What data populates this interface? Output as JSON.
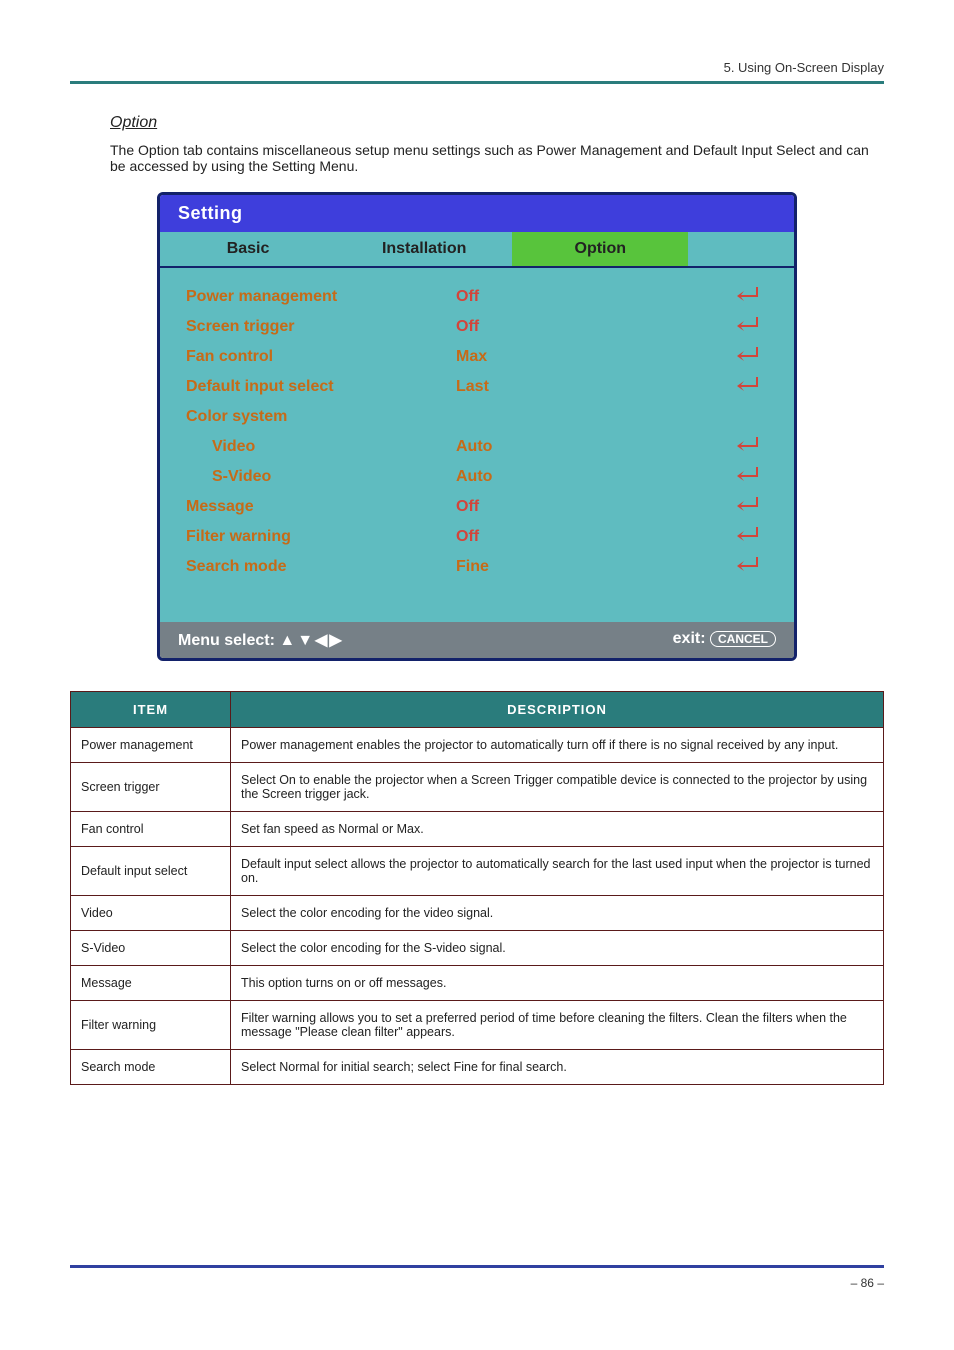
{
  "header": {
    "right_text": "5. Using On-Screen Display"
  },
  "section": {
    "title_underlined": "Option",
    "desc": "The Option tab contains miscellaneous setup menu settings such as Power Management and Default Input Select and can be accessed by using the Setting Menu."
  },
  "osd": {
    "title": "Setting",
    "tabs": {
      "basic": "Basic",
      "installation": "Installation",
      "option": "Option"
    },
    "rows": {
      "power_mgmt": {
        "label": "Power management",
        "value": "Off"
      },
      "screen_trigger": {
        "label": "Screen trigger",
        "value": "Off"
      },
      "fan_control": {
        "label": "Fan control",
        "value": "Max"
      },
      "default_input": {
        "label": "Default input select",
        "value": "Last"
      },
      "color_system": {
        "label": "Color system"
      },
      "video": {
        "label": "Video",
        "value": "Auto"
      },
      "svideo": {
        "label": "S-Video",
        "value": "Auto"
      },
      "message": {
        "label": "Message",
        "value": "Off"
      },
      "filter_warning": {
        "label": "Filter warning",
        "value": "Off"
      },
      "search_mode": {
        "label": "Search mode",
        "value": "Fine"
      }
    },
    "footer": {
      "menu_select": "Menu select:",
      "exit": "exit:",
      "cancel": "CANCEL"
    }
  },
  "table": {
    "head_item": "ITEM",
    "head_desc": "DESCRIPTION",
    "rows": [
      {
        "item": "Power management",
        "desc": "Power management enables the projector to automatically turn off if there is no signal received by any input."
      },
      {
        "item": "Screen trigger",
        "desc": "Select On to enable the projector when a Screen Trigger compatible device is connected to the projector by using the Screen trigger jack."
      },
      {
        "item": "Fan control",
        "desc": "Set fan speed as Normal or Max."
      },
      {
        "item": "Default input select",
        "desc": "Default input select allows the projector to automatically search for the last used input when the projector is turned on."
      },
      {
        "item": "Video",
        "desc": "Select the color encoding for the video signal."
      },
      {
        "item": "S-Video",
        "desc": "Select the color encoding for the S-video signal."
      },
      {
        "item": "Message",
        "desc": "This option turns on or off messages."
      },
      {
        "item": "Filter warning",
        "desc": "Filter warning allows you to set a preferred period of time before cleaning the filters. Clean the filters when the message \"Please clean filter\" appears."
      },
      {
        "item": "Search mode",
        "desc": "Select Normal for initial search; select Fine for final search."
      }
    ]
  },
  "footer": {
    "page_num": "– 86 –",
    "left": ""
  }
}
